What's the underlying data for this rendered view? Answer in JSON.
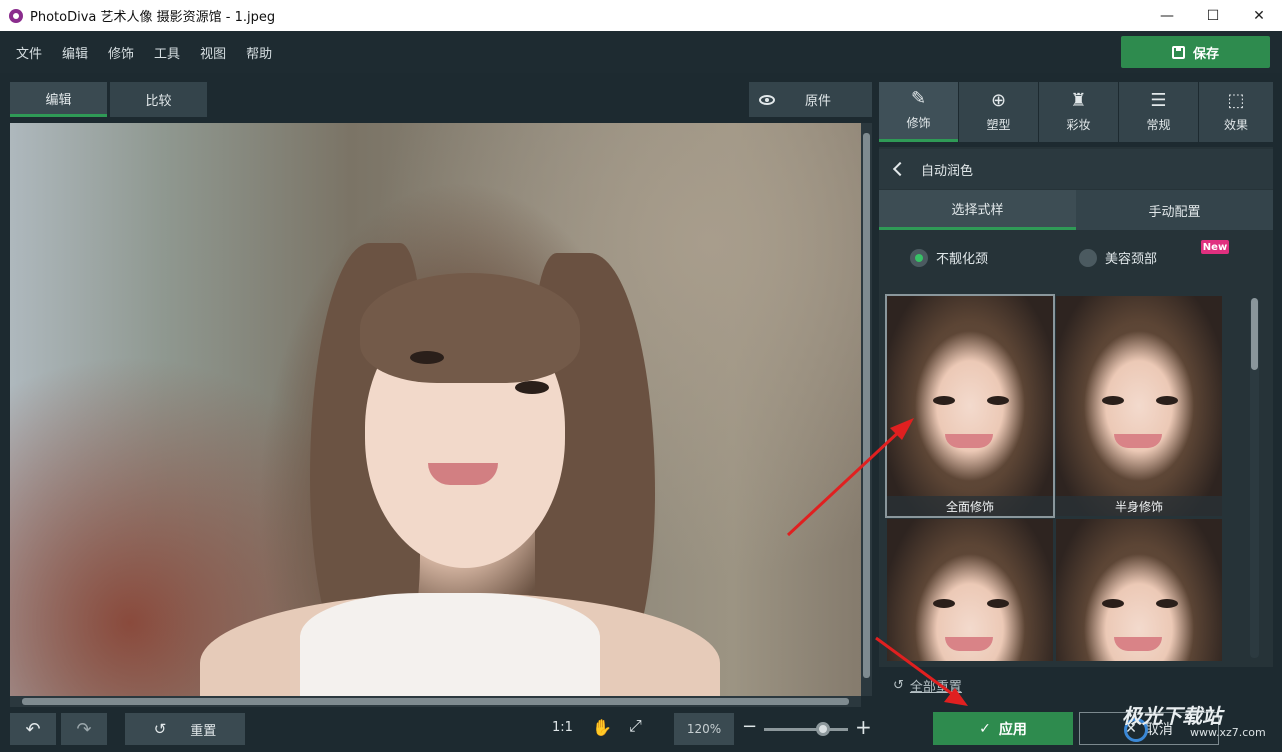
{
  "window": {
    "title": "PhotoDiva 艺术人像 摄影资源馆 - 1.jpeg",
    "controls": [
      "—",
      "☐",
      "✕"
    ]
  },
  "menu": [
    "文件",
    "编辑",
    "修饰",
    "工具",
    "视图",
    "帮助"
  ],
  "save_label": "保存",
  "view_tabs": [
    "编辑",
    "比较"
  ],
  "original_label": "原件",
  "right_tabs": [
    {
      "label": "修饰",
      "icon": "brush-icon"
    },
    {
      "label": "塑型",
      "icon": "shape-icon"
    },
    {
      "label": "彩妆",
      "icon": "makeup-icon"
    },
    {
      "label": "常规",
      "icon": "sliders-icon"
    },
    {
      "label": "效果",
      "icon": "effects-icon"
    }
  ],
  "panel": {
    "header": "自动润色",
    "sub_tabs": [
      "选择式样",
      "手动配置"
    ],
    "radios": [
      {
        "label": "不靓化颈",
        "selected": true
      },
      {
        "label": "美容颈部",
        "selected": false
      }
    ],
    "new_badge": "New",
    "presets": [
      "全面修饰",
      "半身修饰",
      "",
      ""
    ],
    "reset_all": "全部重置"
  },
  "bottom": {
    "reset_label": "重置",
    "ratio_label": "1:1",
    "zoom_value": "120%",
    "zoom_minus": "−",
    "zoom_plus": "+"
  },
  "actions": {
    "apply": "应用",
    "cancel": "取消"
  },
  "watermark": {
    "main": "极光下载站",
    "sub": "www.xz7.com"
  },
  "colors": {
    "accent_green": "#2e8b4e",
    "annotation_red": "#e02020",
    "new_pink": "#e0307f"
  }
}
